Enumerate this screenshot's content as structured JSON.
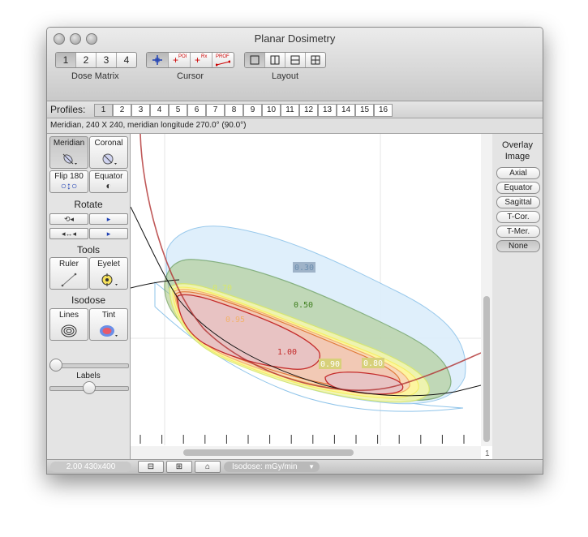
{
  "window": {
    "title": "Planar Dosimetry"
  },
  "toolbar": {
    "dose_matrix": {
      "label": "Dose Matrix",
      "segments": [
        "1",
        "2",
        "3",
        "4"
      ],
      "selected": "1"
    },
    "cursor": {
      "label": "Cursor",
      "segments": [
        "cross",
        "POI",
        "Rx",
        "PROF"
      ],
      "poi_text": "POI",
      "rx_text": "Rx",
      "prof_text": "PROF"
    },
    "layout": {
      "label": "Layout"
    }
  },
  "profiles": {
    "label": "Profiles:",
    "items": [
      "1",
      "2",
      "3",
      "4",
      "5",
      "6",
      "7",
      "8",
      "9",
      "10",
      "11",
      "12",
      "13",
      "14",
      "15",
      "16"
    ],
    "selected": "1"
  },
  "info_line": "Meridian, 240 X 240, meridian longitude 270.0° (90.0°)",
  "left_panel": {
    "meridian": "Meridian",
    "coronal": "Coronal",
    "flip": "Flip 180",
    "equator": "Equator",
    "rotate_label": "Rotate",
    "tools_label": "Tools",
    "ruler": "Ruler",
    "eyelet": "Eyelet",
    "isodose_label": "Isodose",
    "lines": "Lines",
    "tint": "Tint",
    "labels_label": "Labels",
    "slider_top": 0.0,
    "slider_labels": 0.5
  },
  "plot": {
    "isodose_labels": [
      "0.30",
      "0.50",
      "0.70",
      "0.80",
      "0.90",
      "0.95",
      "1.00"
    ],
    "scroll_page": "1",
    "colors": {
      "l30": "#8fc4ea",
      "l50": "#3f7f1f",
      "l70": "#d8e86a",
      "l80": "#f5ef66",
      "l90": "#f2b26a",
      "l95": "#e07a3a",
      "l100": "#c42a2a"
    }
  },
  "overlay": {
    "title_line1": "Overlay",
    "title_line2": "Image",
    "options": [
      "Axial",
      "Equator",
      "Sagittal",
      "T-Cor.",
      "T-Mer.",
      "None"
    ],
    "selected": "None"
  },
  "status": {
    "zoom": "2.00 430x400",
    "isodose_units": "Isodose: mGy/min"
  }
}
